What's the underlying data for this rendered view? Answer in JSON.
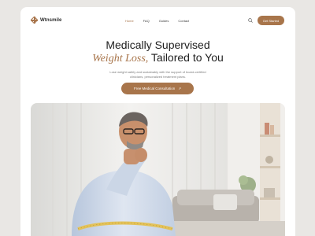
{
  "brand": {
    "name": "Wtnsmile"
  },
  "nav": {
    "links": [
      {
        "label": "Home"
      },
      {
        "label": "FAQ"
      },
      {
        "label": "Guides"
      },
      {
        "label": "Contact"
      }
    ],
    "cta_label": "Get Started"
  },
  "hero": {
    "title_line1": "Medically Supervised",
    "title_emphasis": "Weight Loss,",
    "title_rest": " Tailored to You",
    "subtitle_line1": "Lose weight safely and sustainably with the support of board-certified",
    "subtitle_line2": "clinicians, personalized treatment plans.",
    "cta_label": "Free Medical Consultation",
    "cta_arrow": "↗"
  },
  "colors": {
    "accent": "#a8754b",
    "page_bg": "#e9e7e4"
  }
}
